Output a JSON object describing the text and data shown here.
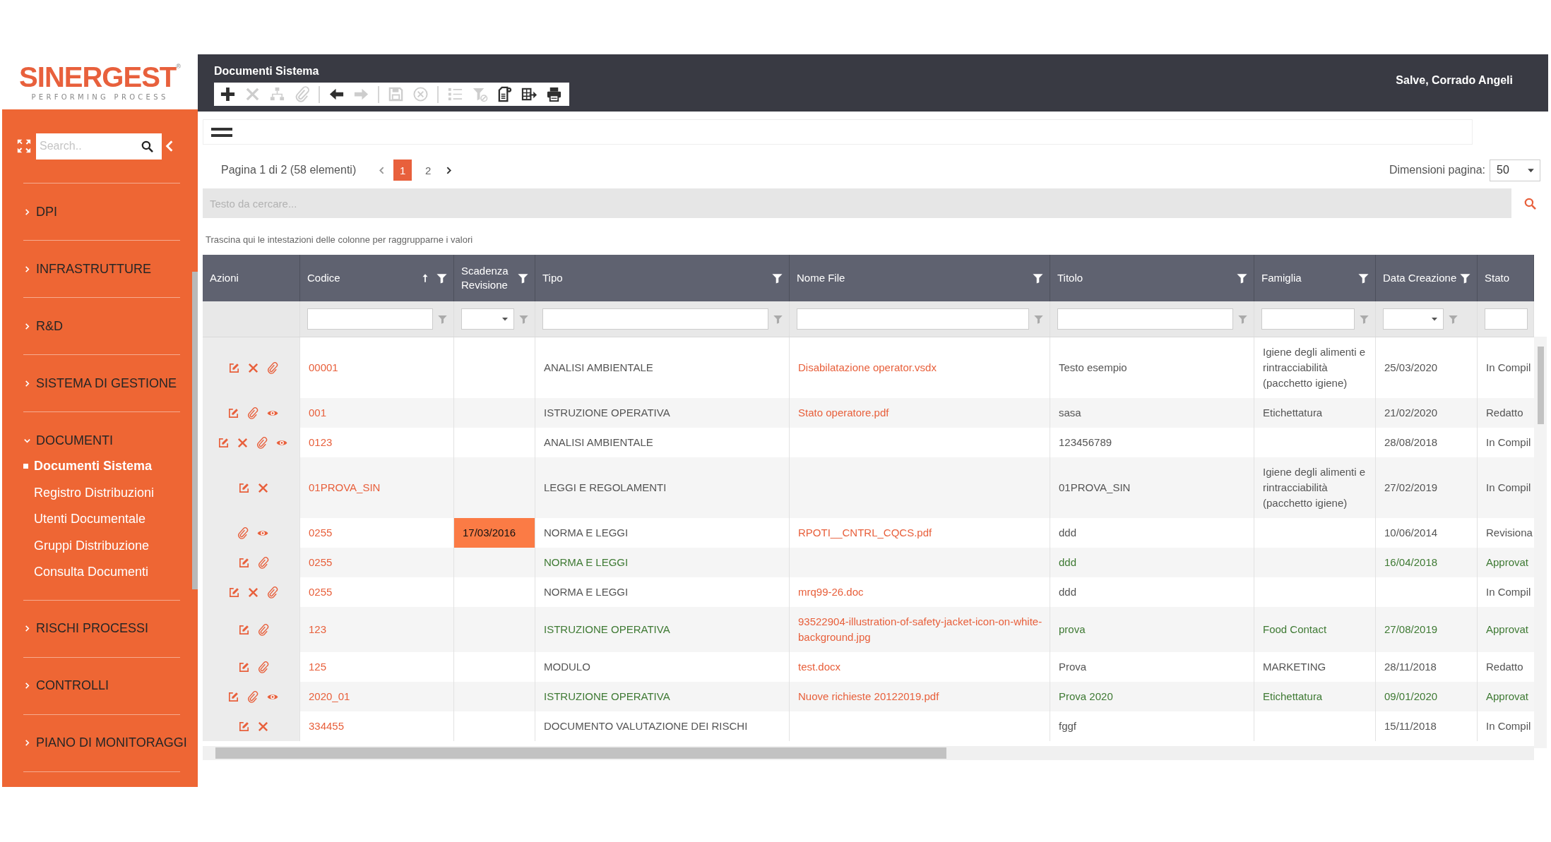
{
  "logo": {
    "name": "SINERGEST",
    "mark": "®",
    "tagline": "PERFORMING PROCESS"
  },
  "sidebar": {
    "search": {
      "placeholder": "Search.."
    },
    "items": [
      {
        "label": "DPI",
        "expanded": false
      },
      {
        "label": "INFRASTRUTTURE",
        "expanded": false
      },
      {
        "label": "R&D",
        "expanded": false
      },
      {
        "label": "SISTEMA DI GESTIONE",
        "expanded": false
      },
      {
        "label": "DOCUMENTI",
        "expanded": true,
        "children": [
          {
            "label": "Documenti Sistema",
            "selected": true
          },
          {
            "label": "Registro Distribuzioni",
            "selected": false
          },
          {
            "label": "Utenti Documentale",
            "selected": false
          },
          {
            "label": "Gruppi Distribuzione",
            "selected": false
          },
          {
            "label": "Consulta Documenti",
            "selected": false
          }
        ]
      },
      {
        "label": "RISCHI PROCESSI",
        "expanded": false
      },
      {
        "label": "CONTROLLI",
        "expanded": false
      },
      {
        "label": "PIANO DI MONITORAGGI",
        "expanded": false
      }
    ]
  },
  "header": {
    "title": "Documenti Sistema",
    "greeting": "Salve, Corrado Angeli"
  },
  "toolbar": [
    {
      "kind": "add",
      "disabled": false
    },
    {
      "kind": "delete",
      "disabled": true
    },
    {
      "kind": "hierarchy",
      "disabled": true
    },
    {
      "kind": "attach",
      "disabled": true
    },
    {
      "kind": "separator"
    },
    {
      "kind": "back",
      "disabled": false
    },
    {
      "kind": "forward",
      "disabled": true
    },
    {
      "kind": "separator"
    },
    {
      "kind": "save",
      "disabled": true
    },
    {
      "kind": "cancel",
      "disabled": true
    },
    {
      "kind": "separator"
    },
    {
      "kind": "list",
      "disabled": true
    },
    {
      "kind": "filter_clear",
      "disabled": true
    },
    {
      "kind": "doc_settings",
      "disabled": false
    },
    {
      "kind": "export",
      "disabled": false
    },
    {
      "kind": "print",
      "disabled": false
    }
  ],
  "pager": {
    "summary": "Pagina 1 di 2 (58 elementi)",
    "pages": [
      {
        "label": "1",
        "selected": true
      },
      {
        "label": "2",
        "selected": false
      }
    ],
    "page_size_label": "Dimensioni pagina:",
    "page_size": "50"
  },
  "search": {
    "placeholder": "Testo da cercare..."
  },
  "group_hint": "Trascina qui le intestazioni delle colonne per raggrupparne i valori",
  "table": {
    "columns": [
      {
        "label": "Azioni",
        "kind": "actions"
      },
      {
        "label": "Codice",
        "kind": "text_filter",
        "sorted": true
      },
      {
        "label": "Scadenza Revisione",
        "kind": "dropdown_filter"
      },
      {
        "label": "Tipo",
        "kind": "text_filter"
      },
      {
        "label": "Nome File",
        "kind": "text_filter"
      },
      {
        "label": "Titolo",
        "kind": "text_filter"
      },
      {
        "label": "Famiglia",
        "kind": "text_filter"
      },
      {
        "label": "Data Creazione",
        "kind": "dropdown_filter"
      },
      {
        "label": "Stato",
        "kind": "text_filter"
      }
    ],
    "rows": [
      {
        "actions": [
          {
            "kind": "edit"
          },
          {
            "kind": "delete"
          },
          {
            "kind": "attach"
          }
        ],
        "codice": "00001",
        "tipo": "ANALISI AMBIENTALE",
        "nome_file": "Disabilatazione operator.vsdx",
        "titolo": "Testo esempio",
        "famiglia": "Igiene degli alimenti e rintracciabilità (pacchetto igiene)",
        "data_creazione": "25/03/2020",
        "stato": "In Compil",
        "approved": false,
        "scadenza_expired": false
      },
      {
        "actions": [
          {
            "kind": "edit"
          },
          {
            "kind": "attach"
          },
          {
            "kind": "view"
          }
        ],
        "codice": "001",
        "tipo": "ISTRUZIONE OPERATIVA",
        "nome_file": "Stato operatore.pdf",
        "titolo": "sasa",
        "famiglia": "Etichettatura",
        "data_creazione": "21/02/2020",
        "stato": "Redatto",
        "approved": false,
        "scadenza_expired": false
      },
      {
        "actions": [
          {
            "kind": "edit"
          },
          {
            "kind": "delete"
          },
          {
            "kind": "attach"
          },
          {
            "kind": "view"
          }
        ],
        "codice": "0123",
        "tipo": "ANALISI AMBIENTALE",
        "titolo": "123456789",
        "data_creazione": "28/08/2018",
        "stato": "In Compil",
        "approved": false,
        "scadenza_expired": false
      },
      {
        "actions": [
          {
            "kind": "edit"
          },
          {
            "kind": "delete"
          }
        ],
        "codice": "01PROVA_SIN",
        "tipo": "LEGGI E REGOLAMENTI",
        "titolo": "01PROVA_SIN",
        "famiglia": "Igiene degli alimenti e rintracciabilità (pacchetto igiene)",
        "data_creazione": "27/02/2019",
        "stato": "In Compil",
        "approved": false,
        "scadenza_expired": false
      },
      {
        "actions": [
          {
            "kind": "attach"
          },
          {
            "kind": "view"
          }
        ],
        "codice": "0255",
        "scadenza": "17/03/2016",
        "tipo": "NORMA E LEGGI",
        "nome_file": "RPOTI__CNTRL_CQCS.pdf",
        "titolo": "ddd",
        "data_creazione": "10/06/2014",
        "stato": "Revisiona",
        "approved": false,
        "scadenza_expired": true
      },
      {
        "actions": [
          {
            "kind": "edit"
          },
          {
            "kind": "attach"
          }
        ],
        "codice": "0255",
        "tipo": "NORMA E LEGGI",
        "titolo": "ddd",
        "data_creazione": "16/04/2018",
        "stato": "Approvat",
        "approved": true,
        "scadenza_expired": false
      },
      {
        "actions": [
          {
            "kind": "edit"
          },
          {
            "kind": "delete"
          },
          {
            "kind": "attach"
          }
        ],
        "codice": "0255",
        "tipo": "NORMA E LEGGI",
        "nome_file": "mrq99-26.doc",
        "titolo": "ddd",
        "stato": "In Compil",
        "approved": false,
        "scadenza_expired": false
      },
      {
        "actions": [
          {
            "kind": "edit"
          },
          {
            "kind": "attach"
          }
        ],
        "codice": "123",
        "tipo": "ISTRUZIONE OPERATIVA",
        "nome_file": "93522904-illustration-of-safety-jacket-icon-on-white-background.jpg",
        "titolo": "prova",
        "famiglia": "Food Contact",
        "data_creazione": "27/08/2019",
        "stato": "Approvat",
        "approved": true,
        "scadenza_expired": false
      },
      {
        "actions": [
          {
            "kind": "edit"
          },
          {
            "kind": "attach"
          }
        ],
        "codice": "125",
        "tipo": "MODULO",
        "nome_file": "test.docx",
        "titolo": "Prova",
        "famiglia": "MARKETING",
        "data_creazione": "28/11/2018",
        "stato": "Redatto",
        "approved": false,
        "scadenza_expired": false
      },
      {
        "actions": [
          {
            "kind": "edit"
          },
          {
            "kind": "attach"
          },
          {
            "kind": "view"
          }
        ],
        "codice": "2020_01",
        "tipo": "ISTRUZIONE OPERATIVA",
        "nome_file": "Nuove richieste 20122019.pdf",
        "titolo": "Prova 2020",
        "famiglia": "Etichettatura",
        "data_creazione": "09/01/2020",
        "stato": "Approvat",
        "approved": true,
        "scadenza_expired": false
      },
      {
        "actions": [
          {
            "kind": "edit"
          },
          {
            "kind": "delete"
          }
        ],
        "codice": "334455",
        "tipo": "DOCUMENTO VALUTAZIONE DEI RISCHI",
        "titolo": "fggf",
        "data_creazione": "15/11/2018",
        "stato": "In Compil",
        "approved": false,
        "scadenza_expired": false
      }
    ]
  }
}
